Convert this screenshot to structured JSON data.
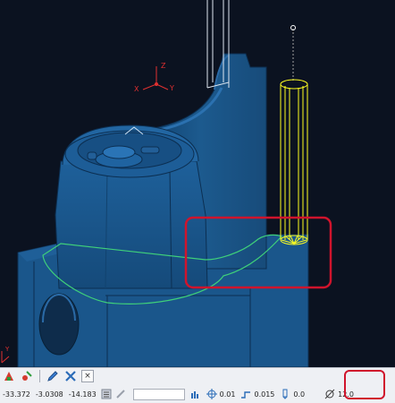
{
  "viewport": {
    "background": "#0b1220",
    "part_color": "#1c5a8e",
    "tool_color": "#ffff20",
    "highlight_color": "#d0142c",
    "axis_triad": {
      "x_label": "X",
      "y_label": "Y",
      "z_label": "Z"
    },
    "axis_triad_bottom": {
      "label": "Y"
    }
  },
  "statusbar": {
    "tools": [
      "pencil-icon",
      "crossed-tools-icon",
      "close-icon"
    ],
    "coords": {
      "x": "-33.372",
      "y": "-3.0308",
      "z": "-14.183"
    },
    "tolerance": "0.01",
    "stepover": "0.015",
    "offset": "0.0",
    "diameter": "12.0"
  }
}
